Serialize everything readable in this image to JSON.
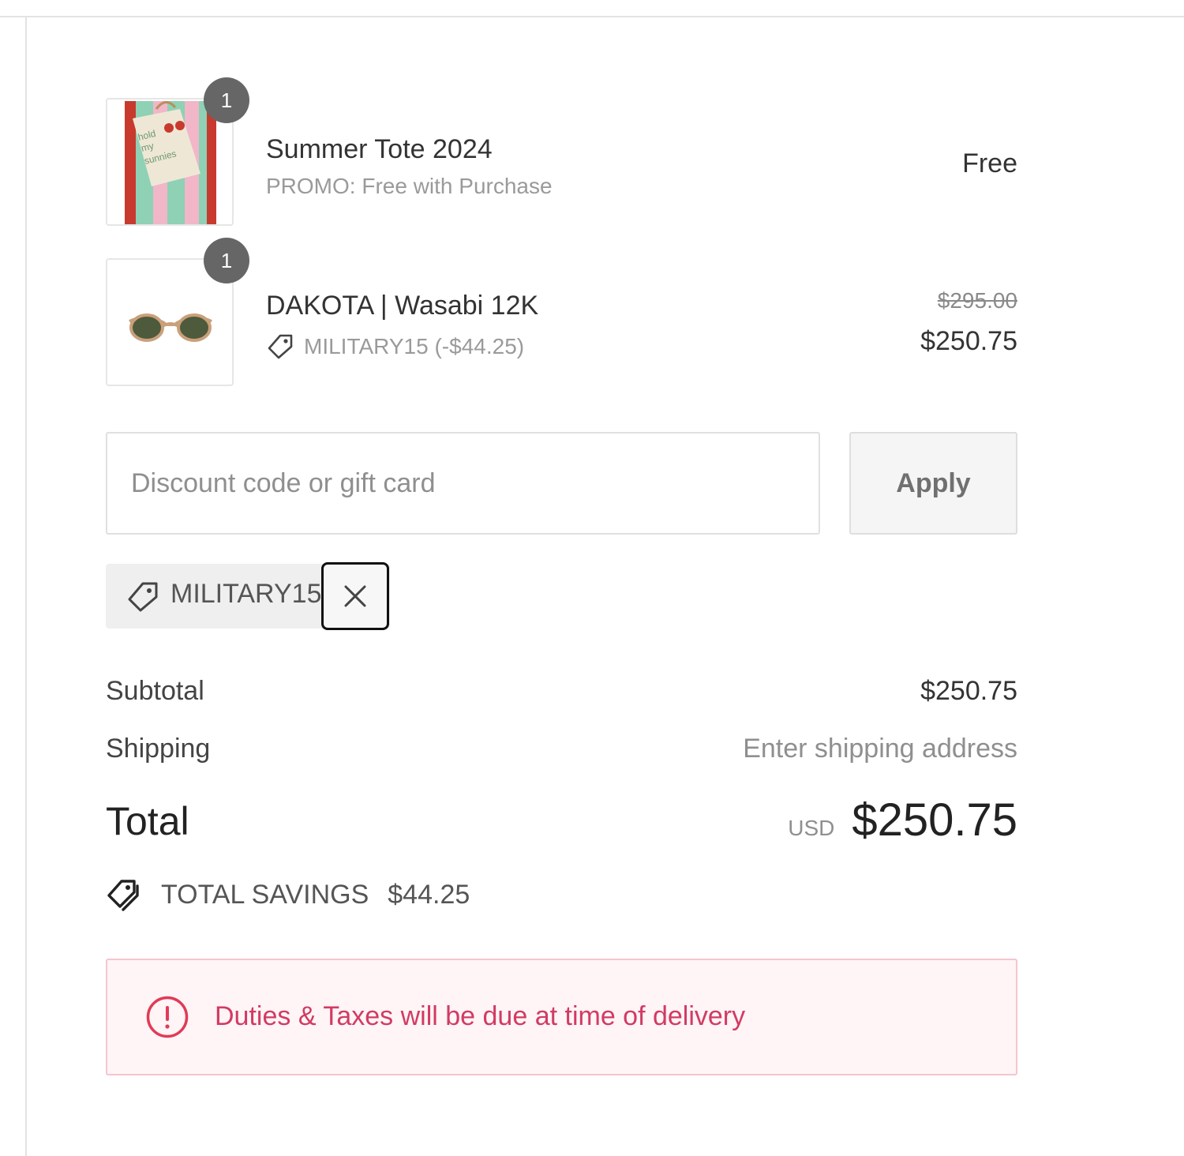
{
  "order_summary": {
    "items": [
      {
        "quantity": "1",
        "title": "Summer Tote 2024",
        "subtitle": "PROMO: Free with Purchase",
        "price": "Free",
        "image_icon": "tote-bag-image"
      },
      {
        "quantity": "1",
        "title": "DAKOTA | Wasabi 12K",
        "discount": "MILITARY15 (-$44.25)",
        "original_price": "$295.00",
        "price": "$250.75",
        "image_icon": "sunglasses-image"
      }
    ],
    "discount": {
      "placeholder": "Discount code or gift card",
      "apply_label": "Apply",
      "applied_code": "MILITARY15",
      "remove_icon": "close-icon"
    },
    "subtotal": {
      "label": "Subtotal",
      "value": "$250.75"
    },
    "shipping": {
      "label": "Shipping",
      "value": "Enter shipping address"
    },
    "total": {
      "label": "Total",
      "currency": "USD",
      "value": "$250.75"
    },
    "savings": {
      "label": "TOTAL SAVINGS",
      "value": "$44.25",
      "icon": "tags-icon"
    },
    "notice": {
      "text": "Duties & Taxes will be due at time of delivery",
      "icon": "alert-circle-icon"
    }
  },
  "colors": {
    "text": "#333333",
    "muted": "#8f8f8f",
    "badge": "#666666",
    "notice_text": "#d13b63",
    "notice_bg": "#fff4f6",
    "notice_border": "#f4c5cf"
  }
}
